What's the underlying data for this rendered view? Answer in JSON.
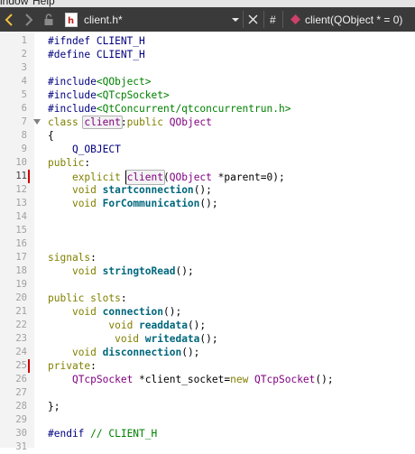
{
  "menubar": {
    "items": [
      "indow",
      "Help"
    ]
  },
  "toolbar": {
    "file_name": "client.h*",
    "hash_symbol": "#",
    "symbol": "client(QObject * = 0)",
    "icons": [
      "back-arrow-icon",
      "forward-arrow-icon",
      "lock-icon",
      "file-h-icon",
      "dropdown-icon",
      "close-icon",
      "symbol-icon"
    ]
  },
  "editor": {
    "lines": [
      {
        "n": "1",
        "segs": [
          {
            "c": "pp",
            "t": "#ifndef CLIENT_H"
          }
        ]
      },
      {
        "n": "2",
        "segs": [
          {
            "c": "pp",
            "t": "#define CLIENT_H"
          }
        ]
      },
      {
        "n": "3",
        "segs": []
      },
      {
        "n": "4",
        "segs": [
          {
            "c": "pp",
            "t": "#include"
          },
          {
            "c": "str",
            "t": "<QObject>"
          }
        ]
      },
      {
        "n": "5",
        "segs": [
          {
            "c": "pp",
            "t": "#include"
          },
          {
            "c": "str",
            "t": "<QTcpSocket>"
          }
        ]
      },
      {
        "n": "6",
        "segs": [
          {
            "c": "pp",
            "t": "#include"
          },
          {
            "c": "str",
            "t": "<QtConcurrent/qtconcurrentrun.h>"
          }
        ]
      },
      {
        "n": "7",
        "fold": true,
        "segs": [
          {
            "c": "kw",
            "t": "class "
          },
          {
            "c": "ty hl",
            "t": "client"
          },
          {
            "c": "",
            "t": ":"
          },
          {
            "c": "kw",
            "t": "public "
          },
          {
            "c": "ty",
            "t": "QObject"
          }
        ]
      },
      {
        "n": "8",
        "segs": [
          {
            "c": "",
            "t": "{"
          }
        ]
      },
      {
        "n": "9",
        "segs": [
          {
            "c": "",
            "t": "    "
          },
          {
            "c": "mac",
            "t": "Q_OBJECT"
          }
        ]
      },
      {
        "n": "10",
        "segs": [
          {
            "c": "kw",
            "t": "public"
          },
          {
            "c": "",
            "t": ":"
          }
        ]
      },
      {
        "n": "11",
        "cur": true,
        "mod": true,
        "segs": [
          {
            "c": "",
            "t": "    "
          },
          {
            "c": "kw",
            "t": "explicit "
          },
          {
            "c": "ty hl cursor",
            "t": "client"
          },
          {
            "c": "",
            "t": "("
          },
          {
            "c": "ty",
            "t": "QObject"
          },
          {
            "c": "",
            "t": " *parent=0);"
          }
        ]
      },
      {
        "n": "12",
        "segs": [
          {
            "c": "",
            "t": "    "
          },
          {
            "c": "kw",
            "t": "void "
          },
          {
            "c": "fn",
            "t": "startconnection"
          },
          {
            "c": "",
            "t": "();"
          }
        ]
      },
      {
        "n": "13",
        "segs": [
          {
            "c": "",
            "t": "    "
          },
          {
            "c": "kw",
            "t": "void "
          },
          {
            "c": "fn",
            "t": "ForCommunication"
          },
          {
            "c": "",
            "t": "();"
          }
        ]
      },
      {
        "n": "14",
        "segs": []
      },
      {
        "n": "15",
        "segs": []
      },
      {
        "n": "16",
        "segs": []
      },
      {
        "n": "17",
        "segs": [
          {
            "c": "kw",
            "t": "signals"
          },
          {
            "c": "",
            "t": ":"
          }
        ]
      },
      {
        "n": "18",
        "segs": [
          {
            "c": "",
            "t": "    "
          },
          {
            "c": "kw",
            "t": "void "
          },
          {
            "c": "fn",
            "t": "stringtoRead"
          },
          {
            "c": "",
            "t": "();"
          }
        ]
      },
      {
        "n": "19",
        "segs": []
      },
      {
        "n": "20",
        "segs": [
          {
            "c": "kw",
            "t": "public slots"
          },
          {
            "c": "",
            "t": ":"
          }
        ]
      },
      {
        "n": "21",
        "segs": [
          {
            "c": "",
            "t": "    "
          },
          {
            "c": "kw",
            "t": "void "
          },
          {
            "c": "fn",
            "t": "connection"
          },
          {
            "c": "",
            "t": "();"
          }
        ]
      },
      {
        "n": "22",
        "segs": [
          {
            "c": "",
            "t": "          "
          },
          {
            "c": "kw",
            "t": "void "
          },
          {
            "c": "fn",
            "t": "readdata"
          },
          {
            "c": "",
            "t": "();"
          }
        ]
      },
      {
        "n": "23",
        "segs": [
          {
            "c": "",
            "t": "           "
          },
          {
            "c": "kw",
            "t": "void "
          },
          {
            "c": "fn",
            "t": "writedata"
          },
          {
            "c": "",
            "t": "();"
          }
        ]
      },
      {
        "n": "24",
        "segs": [
          {
            "c": "",
            "t": "    "
          },
          {
            "c": "kw",
            "t": "void "
          },
          {
            "c": "fn",
            "t": "disconnection"
          },
          {
            "c": "",
            "t": "();"
          }
        ]
      },
      {
        "n": "25",
        "mod": true,
        "segs": [
          {
            "c": "kw",
            "t": "private"
          },
          {
            "c": "",
            "t": ":"
          }
        ]
      },
      {
        "n": "26",
        "segs": [
          {
            "c": "",
            "t": "    "
          },
          {
            "c": "ty",
            "t": "QTcpSocket"
          },
          {
            "c": "",
            "t": " *client_socket="
          },
          {
            "c": "kw",
            "t": "new "
          },
          {
            "c": "ty",
            "t": "QTcpSocket"
          },
          {
            "c": "",
            "t": "();"
          }
        ]
      },
      {
        "n": "27",
        "segs": []
      },
      {
        "n": "28",
        "segs": [
          {
            "c": "",
            "t": "};"
          }
        ]
      },
      {
        "n": "29",
        "segs": []
      },
      {
        "n": "30",
        "segs": [
          {
            "c": "pp",
            "t": "#endif "
          },
          {
            "c": "cmt",
            "t": "// CLIENT_H"
          }
        ]
      },
      {
        "n": "31",
        "segs": []
      }
    ]
  },
  "colors": {
    "toolbar_bg": "#3a3a3a",
    "gutter_bg": "#f3f3f3",
    "modified_marker": "#d00000",
    "keyword": "#808000",
    "type": "#800080",
    "function": "#00677c",
    "preprocessor": "#000080",
    "string": "#008000"
  }
}
